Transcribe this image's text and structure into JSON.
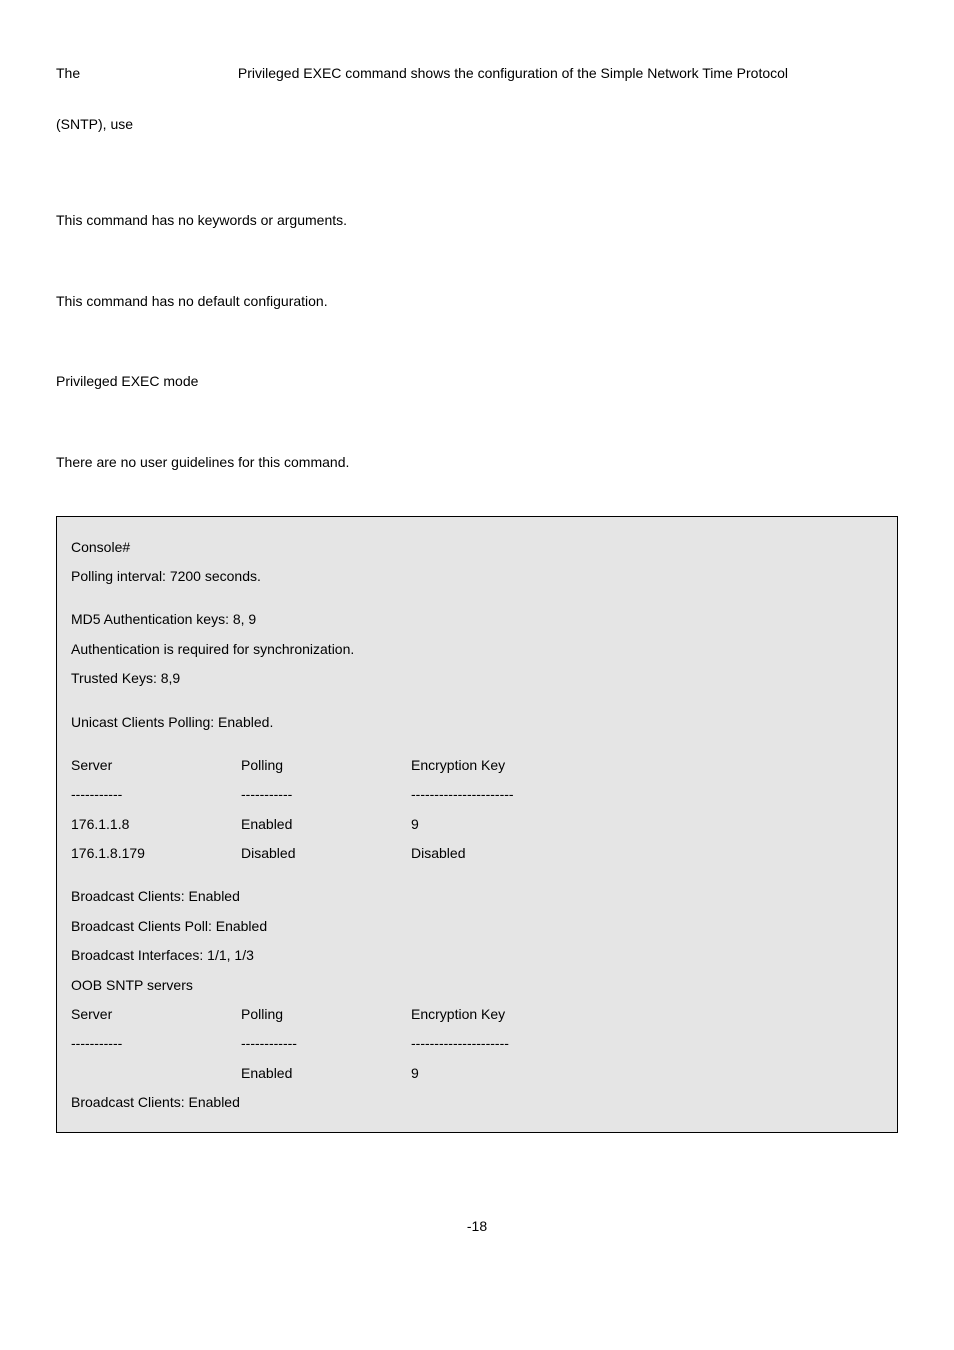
{
  "intro": {
    "prefix": "The",
    "rest": "Privileged EXEC command shows the configuration of the Simple Network Time Protocol",
    "second": "(SNTP), use"
  },
  "sections": {
    "keywords": "This command has no keywords or arguments.",
    "default": "This command has no default configuration.",
    "mode": "Privileged EXEC mode",
    "guidelines": "There are no user guidelines for this command."
  },
  "console": {
    "prompt": "Console#",
    "polling_interval": "Polling interval: 7200 seconds.",
    "md5_keys": "MD5 Authentication keys: 8, 9",
    "auth_required": "Authentication is required for synchronization.",
    "trusted_keys": "Trusted Keys: 8,9",
    "unicast": "Unicast Clients Polling: Enabled.",
    "hdr": {
      "server": "Server",
      "polling": "Polling",
      "enckey": "Encryption Key"
    },
    "sep": {
      "c1": "-----------",
      "c2": "-----------",
      "c3": "----------------------"
    },
    "rows1": [
      {
        "server": "176.1.1.8",
        "polling": "Enabled",
        "enckey": " 9"
      },
      {
        "server": "176.1.8.179",
        "polling": "Disabled",
        "enckey": "Disabled"
      }
    ],
    "broadcast_enabled": "Broadcast Clients: Enabled",
    "broadcast_poll": "Broadcast Clients Poll: Enabled",
    "broadcast_if": "Broadcast Interfaces: 1/1, 1/3",
    "oob": "OOB SNTP servers",
    "sep2": {
      "c1": "-----------",
      "c2": "------------",
      "c3": "---------------------"
    },
    "rows2": [
      {
        "server": "",
        "polling": "Enabled",
        "enckey": " 9"
      }
    ],
    "broadcast_enabled2": "Broadcast Clients: Enabled"
  },
  "footer": "-18"
}
